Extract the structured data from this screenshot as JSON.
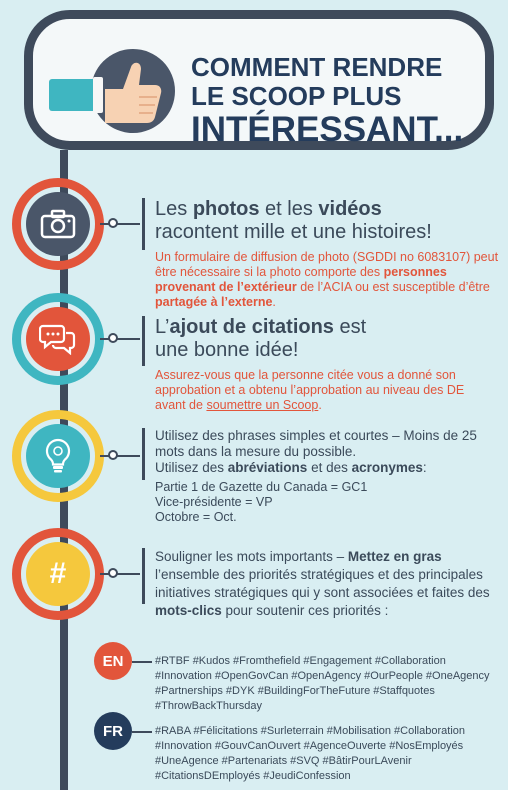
{
  "header": {
    "title_line1": "COMMENT RENDRE",
    "title_line2": "LE SCOOP PLUS",
    "title_line3": "INTÉRESSANT..."
  },
  "icons": {
    "header": "thumbs-up-icon",
    "s1": "camera-icon",
    "s2": "speech-bubbles-icon",
    "s3": "lightbulb-icon",
    "s4": "hashtag-symbol"
  },
  "colors": {
    "navy": "#3e4a5b",
    "title": "#243c5c",
    "accent_red": "#e2553b",
    "teal": "#3fb6c1",
    "yellow": "#f5c83d",
    "background": "#d9eef2"
  },
  "s1": {
    "h_a": "Les ",
    "h_b": "photos",
    "h_c": " et les ",
    "h_d": "vidéos",
    "h_e": "racontent mille et une histoires!",
    "n_a": "Un formulaire de diffusion de photo (SGDDI no 6083107) peut être nécessaire si la photo comporte des ",
    "n_b": "personnes provenant de l’extérieur",
    "n_c": " de l’ACIA ou est susceptible d’être ",
    "n_d": "partagée à l’externe",
    "n_e": "."
  },
  "s2": {
    "h_a": "L’",
    "h_b": "ajout de citations",
    "h_c": " est",
    "h_d": "une bonne idée!",
    "n_a": "Assurez-vous que la personne citée vous a donné son approbation et a obtenu l’approbation au niveau des DE avant de ",
    "n_b": "soumettre un Scoop",
    "n_c": "."
  },
  "s3": {
    "p1": "Utilisez des phrases simples et courtes – Moins de 25 mots dans la mesure du possible.",
    "p2_a": "Utilisez des ",
    "p2_b": "abréviations",
    "p2_c": " et des ",
    "p2_d": "acronymes",
    "p2_e": ":",
    "ex1": "Partie 1 de Gazette du Canada = GC1",
    "ex2": "Vice-présidente = VP",
    "ex3": "Octobre = Oct."
  },
  "s4": {
    "symbol": "#",
    "p_a": "Souligner les mots importants – ",
    "p_b": "Mettez en gras",
    "p_c": " l’ensemble des priorités stratégiques et des principales initiatives stratégiques qui y sont associées et faites des ",
    "p_d": "mots-clics",
    "p_e": "  pour soutenir ces priorités :"
  },
  "en": {
    "label": "EN",
    "tags": "#RTBF #Kudos #Fromthefield #Engagement #Collaboration #Innovation #OpenGovCan #OpenAgency #OurPeople #OneAgency #Partnerships #DYK #BuildingForTheFuture #Staffquotes #ThrowBackThursday"
  },
  "fr": {
    "label": "FR",
    "tags": "#RABA #Félicitations #Surleterrain #Mobilisation #Collaboration #Innovation #GouvCanOuvert #AgenceOuverte #NosEmployés #UneAgence  #Partenariats #SVQ #BâtirPourLAvenir #CitationsDEmployés #JeudiConfession"
  }
}
